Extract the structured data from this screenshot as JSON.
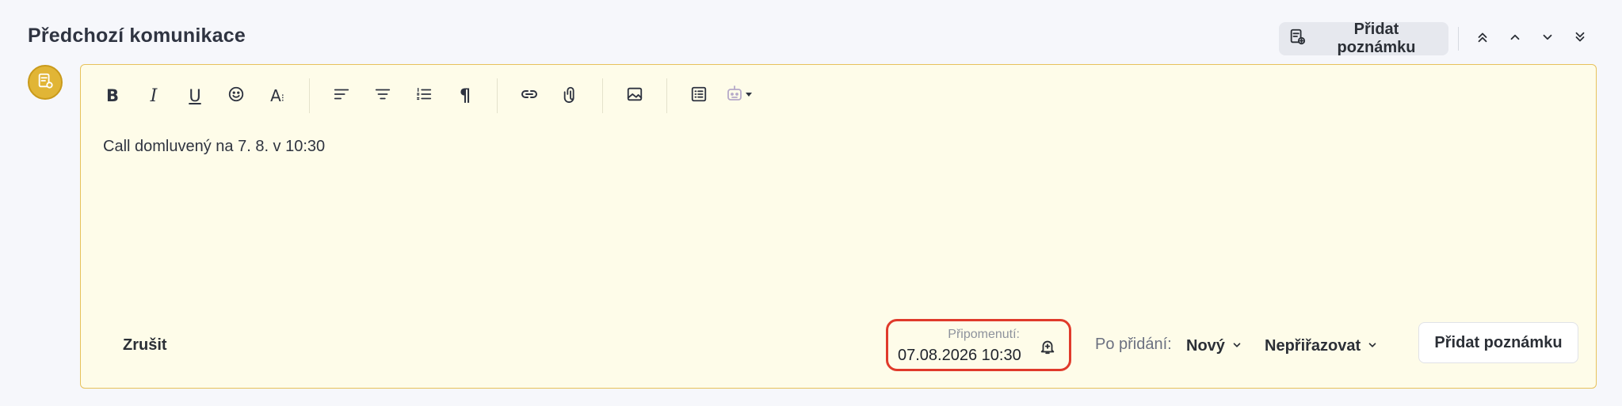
{
  "section": {
    "title": "Předchozí komunikace"
  },
  "header_actions": {
    "add_note_label": "Přidat poznámku",
    "nav": [
      "first-icon",
      "previous-icon",
      "next-icon",
      "last-icon"
    ]
  },
  "note": {
    "avatar_icon": "note-icon",
    "toolbar": {
      "groups": [
        [
          "bold-icon",
          "italic-icon",
          "underline-icon",
          "emoji-icon",
          "text-size-icon"
        ],
        [
          "align-left-icon",
          "align-center-icon",
          "numbered-list-icon",
          "paragraph-icon"
        ],
        [
          "link-icon",
          "attachment-icon"
        ],
        [
          "image-icon"
        ],
        [
          "table-icon",
          "ai-assistant-icon"
        ]
      ]
    },
    "content": "Call domluvený na 7. 8. v 10:30"
  },
  "footer": {
    "cancel_label": "Zrušit",
    "reminder": {
      "label": "Připomenutí:",
      "value": "07.08.2026 10:30",
      "icon": "bell-plus-icon"
    },
    "after_add_label": "Po přidání:",
    "status_value": "Nový",
    "assign_value": "Nepřiřazovat",
    "submit_label": "Přidat poznámku"
  },
  "colors": {
    "accent_yellow": "#e1b536",
    "editor_bg": "#fefce9",
    "highlight_red": "#e03a2b"
  }
}
